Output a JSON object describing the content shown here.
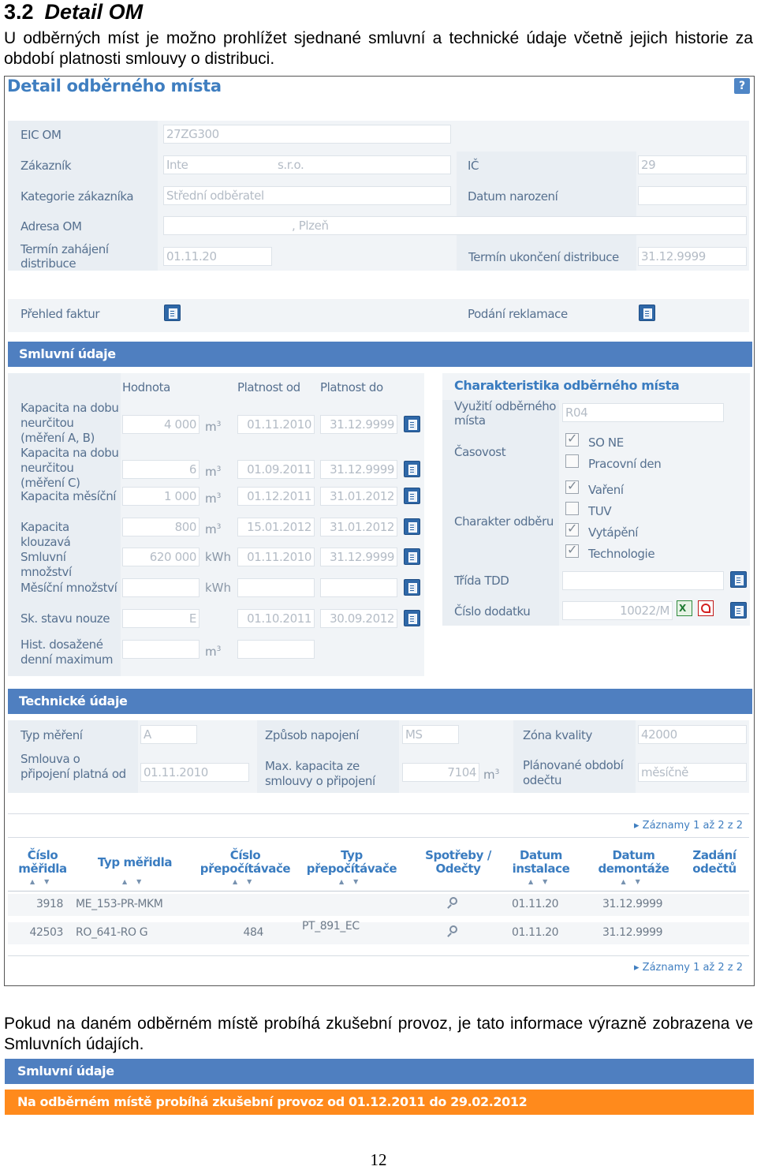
{
  "section": {
    "number": "3.2",
    "title": "Detail OM"
  },
  "intro": "U odběrných míst je možno prohlížet sjednané smluvní a technické údaje včetně jejich historie za období platnosti smlouvy o distribuci.",
  "panel": {
    "title": "Detail odběrného místa",
    "eic_label": "EIC OM",
    "eic_value": "27ZG300",
    "customer_label": "Zákazník",
    "customer_value": "Inte",
    "customer_suffix": "s.r.o.",
    "ic_label": "IČ",
    "ic_value": "29",
    "category_label": "Kategorie zákazníka",
    "category_value": "Střední odběratel",
    "birth_label": "Datum narození",
    "birth_value": "",
    "address_label": "Adresa OM",
    "address_value": ", Plzeň",
    "start_label": "Termín zahájení distribuce",
    "start_value": "01.11.20",
    "end_label": "Termín ukončení distribuce",
    "end_value": "31.12.9999",
    "invoices_label": "Přehled faktur",
    "complaint_label": "Podání reklamace"
  },
  "contract": {
    "bar_label": "Smluvní údaje",
    "col_value": "Hodnota",
    "col_from": "Platnost od",
    "col_to": "Platnost do",
    "rows": [
      {
        "label": "Kapacita na dobu neurčitou (měření A, B)",
        "value": "4 000",
        "unit": "m",
        "sup": "3",
        "from": "01.11.2010",
        "to": "31.12.9999",
        "btn": true
      },
      {
        "label": "Kapacita na dobu neurčitou (měření C)",
        "value": "6",
        "unit": "m",
        "sup": "3",
        "from": "01.09.2011",
        "to": "31.12.9999",
        "btn": true
      },
      {
        "label": "Kapacita měsíční",
        "value": "1 000",
        "unit": "m",
        "sup": "3",
        "from": "01.12.2011",
        "to": "31.01.2012",
        "btn": true
      },
      {
        "label": "Kapacita klouzavá",
        "value": "800",
        "unit": "m",
        "sup": "3",
        "from": "15.01.2012",
        "to": "31.01.2012",
        "btn": true
      },
      {
        "label": "Smluvní množství",
        "value": "620 000",
        "unit": "kWh",
        "sup": "",
        "from": "01.11.2010",
        "to": "31.12.9999",
        "btn": true
      },
      {
        "label": "Měsíční množství",
        "value": "",
        "unit": "kWh",
        "sup": "",
        "from": "",
        "to": "",
        "btn": true
      },
      {
        "label": "Sk. stavu nouze",
        "value": "E",
        "unit": "",
        "sup": "",
        "from": "01.10.2011",
        "to": "30.09.2012",
        "btn": true
      },
      {
        "label": "Hist. dosažené denní maximum",
        "value": "",
        "unit": "m",
        "sup": "3",
        "from": "",
        "to": null,
        "btn": false
      }
    ],
    "char_title": "Charakteristika odběrného místa",
    "usage_label": "Využití odběrného místa",
    "usage_value": "R04",
    "time_label": "Časovost",
    "time_opts": [
      {
        "label": "SO NE",
        "checked": true
      },
      {
        "label": "Pracovní den",
        "checked": false
      }
    ],
    "char_label": "Charakter odběru",
    "char_opts": [
      {
        "label": "Vaření",
        "checked": true
      },
      {
        "label": "TUV",
        "checked": false
      },
      {
        "label": "Vytápění",
        "checked": true
      },
      {
        "label": "Technologie",
        "checked": true
      }
    ],
    "tdd_label": "Třída TDD",
    "tdd_value": "",
    "addendum_label": "Číslo dodatku",
    "addendum_value": "10022/M"
  },
  "technical": {
    "bar_label": "Technické údaje",
    "meter_type_label": "Typ měření",
    "meter_type_value": "A",
    "connection_label": "Způsob napojení",
    "connection_value": "MS",
    "quality_label": "Zóna kvality",
    "quality_value": "42000",
    "valid_label": "Smlouva o připojení platná od",
    "valid_value": "01.11.2010",
    "maxcap_label": "Max. kapacita ze smlouvy o připojení",
    "maxcap_value": "7104",
    "maxcap_unit": "m",
    "maxcap_sup": "3",
    "period_label": "Plánované období odečtu",
    "period_value": "měsíčně"
  },
  "meters": {
    "pager": "Záznamy 1 až 2 z 2",
    "columns": [
      "Číslo měřidla",
      "Typ měřidla",
      "Číslo přepočítávače",
      "Typ přepočítávače",
      "Spotřeby / Odečty",
      "Datum instalace",
      "Datum demontáže",
      "Zadání odečtů"
    ],
    "rows": [
      {
        "number": "3918",
        "type": "ME_153-PR-MKM",
        "conv_number": "",
        "conv_type": "",
        "installed": "01.11.20",
        "removed": "31.12.9999"
      },
      {
        "number": "42503",
        "type": "RO_641-RO G",
        "conv_number": "484",
        "conv_type": "PT_891_EC",
        "installed": "01.11.20",
        "removed": "31.12.9999"
      }
    ]
  },
  "after_text": "Pokud na daném odběrném místě probíhá zkušební provoz, je tato informace výrazně zobrazena ve Smluvních údajích.",
  "trial": {
    "bar_label": "Smluvní údaje",
    "notice": "Na odběrném místě probíhá zkušební provoz od 01.12.2011 do 29.02.2012"
  },
  "page_number": "12",
  "colors": {
    "accent_blue": "#4f7fc0",
    "title_blue": "#3f7ec0",
    "notice_orange": "#ff8a1c",
    "label_gray": "#56708f"
  }
}
